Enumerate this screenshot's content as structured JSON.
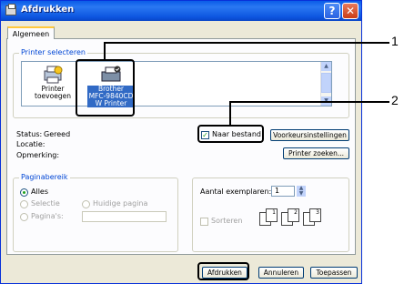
{
  "window": {
    "title": "Afdrukken"
  },
  "tabs": [
    {
      "label": "Algemeen"
    }
  ],
  "printer_select": {
    "legend": "Printer selecteren",
    "items": [
      {
        "label_line1": "Printer",
        "label_line2": "toevoegen",
        "icon": "add-printer-icon"
      },
      {
        "label_line1": "Brother",
        "label_line2": "MFC-9840CD",
        "label_line3": "W Printer",
        "icon": "printer-icon",
        "selected": true
      }
    ]
  },
  "status": {
    "status_label": "Status:",
    "status_value": "Gereed",
    "location_label": "Locatie:",
    "comment_label": "Opmerking:"
  },
  "print_to_file": {
    "label": "Naar bestand",
    "checked": true
  },
  "buttons": {
    "preferences": "Voorkeursinstellingen",
    "find_printer": "Printer zoeken...",
    "print": "Afdrukken",
    "cancel": "Annuleren",
    "apply": "Toepassen"
  },
  "page_range": {
    "legend": "Paginabereik",
    "all": "Alles",
    "selection": "Selectie",
    "current_page": "Huidige pagina",
    "pages": "Pagina's:"
  },
  "copies": {
    "label": "Aantal exemplaren:",
    "value": "1",
    "collate": "Sorteren"
  },
  "collate_icons": [
    "1",
    "1",
    "2",
    "2",
    "3",
    "3"
  ],
  "callouts": [
    "1",
    "2"
  ]
}
